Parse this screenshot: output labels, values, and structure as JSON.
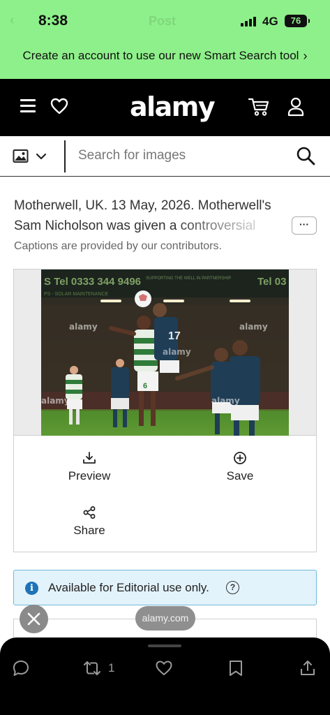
{
  "status_bar": {
    "time": "8:38",
    "network": "4G",
    "battery": "76",
    "ghost_title": "Post"
  },
  "promo": {
    "text": "Create an account to use our new Smart Search tool",
    "chevron": "›"
  },
  "header": {
    "logo": "alamy",
    "icons": [
      "menu-icon",
      "heart-icon",
      "cart-icon",
      "user-icon"
    ]
  },
  "search": {
    "placeholder": "Search for images",
    "type_icon": "image-icon"
  },
  "caption": {
    "text": "Motherwell, UK. 13 May, 2026. Motherwell's Sam Nicholson was given a controversial",
    "more_label": "···",
    "note": "Captions are provided by our contributors."
  },
  "actions": {
    "preview": "Preview",
    "save": "Save",
    "share": "Share"
  },
  "photo": {
    "watermark": "alamy",
    "board_left": "S Tel 0333 344 9496",
    "board_mid": "SUPPORTING THE WELL IN PARTNERSHIP",
    "board_right": "Tel 03",
    "board_sub": "PS - SOLAR MAINTENANCE",
    "shirt_numbers": [
      "17",
      "6"
    ]
  },
  "info": {
    "text": "Available for Editorial use only.",
    "icon": "i",
    "help": "?"
  },
  "overlay": {
    "url": "alamy.com"
  },
  "bottom_bar": {
    "retweet_count": "1"
  }
}
